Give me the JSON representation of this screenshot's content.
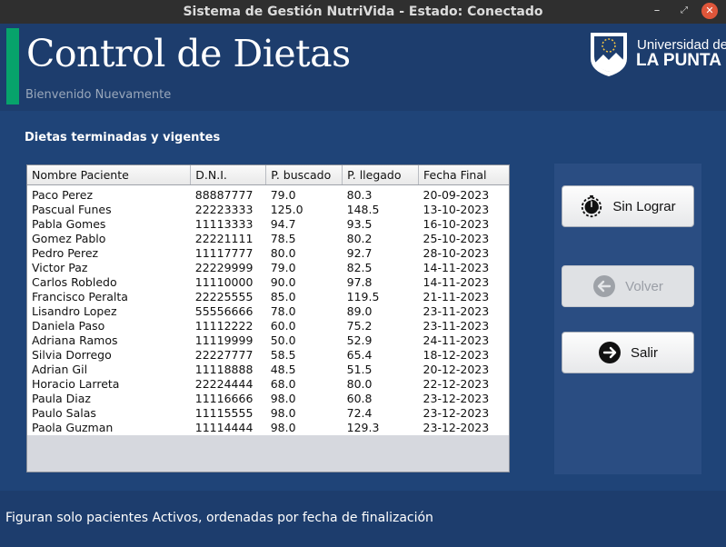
{
  "window": {
    "title": "Sistema de Gestión NutriVida - Estado: Conectado",
    "min_glyph": "–",
    "max_glyph": "⤢",
    "close_glyph": "✕"
  },
  "header": {
    "title": "Control de Dietas",
    "welcome": "Bienvenido Nuevamente",
    "accent_color": "#07a36b",
    "logo": {
      "line1": "Universidad de",
      "line2": "LA PUNTA"
    }
  },
  "main": {
    "section_title": "Dietas terminadas y vigentes",
    "table": {
      "columns": [
        "Nombre Paciente",
        "D.N.I.",
        "P. buscado",
        "P. llegado",
        "Fecha Final"
      ],
      "rows": [
        [
          "Paco Perez",
          "88887777",
          "79.0",
          "80.3",
          "20-09-2023"
        ],
        [
          "Pascual Funes",
          "22223333",
          "125.0",
          "148.5",
          "13-10-2023"
        ],
        [
          "Pabla Gomes",
          "11113333",
          "94.7",
          "93.5",
          "16-10-2023"
        ],
        [
          "Gomez Pablo",
          "22221111",
          "78.5",
          "80.2",
          "25-10-2023"
        ],
        [
          "Pedro Perez",
          "11117777",
          "80.0",
          "92.7",
          "28-10-2023"
        ],
        [
          "Victor Paz",
          "22229999",
          "79.0",
          "82.5",
          "14-11-2023"
        ],
        [
          "Carlos Robledo",
          "11110000",
          "90.0",
          "97.8",
          "14-11-2023"
        ],
        [
          "Francisco Peralta",
          "22225555",
          "85.0",
          "119.5",
          "21-11-2023"
        ],
        [
          "Lisandro Lopez",
          "55556666",
          "78.0",
          "89.0",
          "23-11-2023"
        ],
        [
          "Daniela Paso",
          "11112222",
          "60.0",
          "75.2",
          "23-11-2023"
        ],
        [
          "Adriana Ramos",
          "11119999",
          "50.0",
          "52.9",
          "24-11-2023"
        ],
        [
          "Silvia Dorrego",
          "22227777",
          "58.5",
          "65.4",
          "18-12-2023"
        ],
        [
          "Adrian Gil",
          "11118888",
          "48.5",
          "51.5",
          "20-12-2023"
        ],
        [
          "Horacio Larreta",
          "22224444",
          "68.0",
          "80.0",
          "22-12-2023"
        ],
        [
          "Paula Diaz",
          "11116666",
          "98.0",
          "60.8",
          "23-12-2023"
        ],
        [
          "Paulo Salas",
          "11115555",
          "98.0",
          "72.4",
          "23-12-2023"
        ],
        [
          "Paola Guzman",
          "11114444",
          "98.0",
          "129.3",
          "23-12-2023"
        ]
      ]
    }
  },
  "actions": {
    "sin_lograr": {
      "label": "Sin Lograr",
      "icon": "stopwatch-icon"
    },
    "volver": {
      "label": "Volver",
      "icon": "arrow-left-circle-icon",
      "disabled": true
    },
    "salir": {
      "label": "Salir",
      "icon": "arrow-right-circle-icon"
    }
  },
  "footer": {
    "text": "Figuran solo pacientes Activos, ordenadas por fecha de finalización"
  }
}
